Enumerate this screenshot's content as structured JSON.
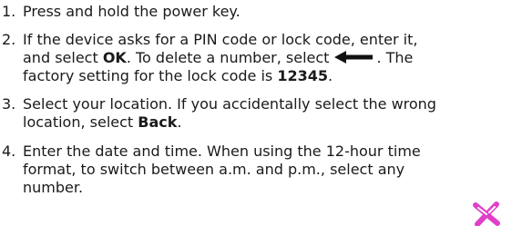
{
  "steps": [
    {
      "number": "1.",
      "line1": "Press and hold the power key."
    },
    {
      "number": "2.",
      "line1": "If the device asks for a PIN code or lock code, enter it,",
      "line2_pre": "and select ",
      "ok": "OK",
      "line2_mid": ". To delete a number, select",
      "line2_post": ". The",
      "line3_pre": "factory setting for the lock code is ",
      "code": "12345",
      "line3_post": "."
    },
    {
      "number": "3.",
      "line1": "Select your location. If you accidentally select the wrong",
      "line2_pre": "location, select ",
      "back": "Back",
      "line2_post": "."
    },
    {
      "number": "4.",
      "line1": "Enter the date and time. When using the 12-hour time",
      "line2": "format, to switch between a.m. and p.m., select any",
      "line3": "number."
    }
  ],
  "icons": {
    "delete": "backspace-arrow-icon",
    "watermark": "pink-cross-watermark-icon",
    "watermark_color": "#e040c8"
  }
}
